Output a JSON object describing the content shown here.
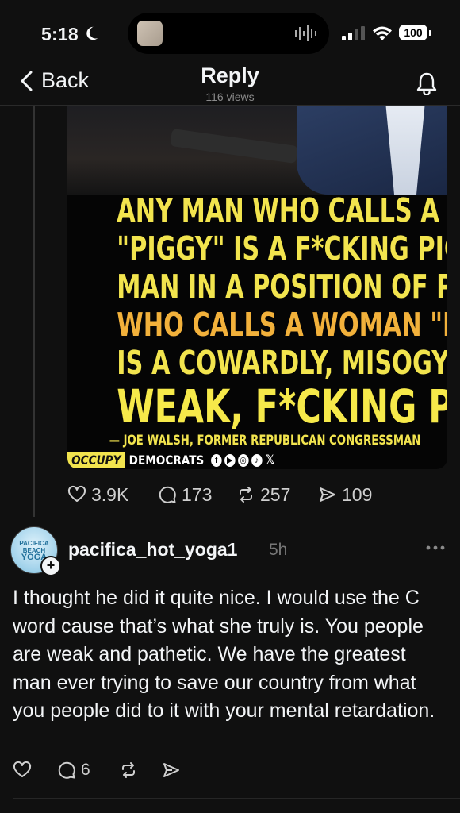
{
  "status_bar": {
    "time": "5:18",
    "battery": "100"
  },
  "nav": {
    "back_label": "Back",
    "title": "Reply",
    "views": "116 views"
  },
  "media": {
    "quote_lines": [
      "ANY MAN WHO CALLS A WOMAN",
      "\"PIGGY\" IS A F*CKING PIG. ANY",
      "MAN IN A POSITION OF POWER",
      "WHO CALLS A WOMAN \"PIGGY\"",
      "IS A COWARDLY, MISOGYNISTIC,",
      "WEAK, F*CKING PIG."
    ],
    "attribution": "— JOE WALSH, FORMER REPUBLICAN CONGRESSMAN",
    "brand_occupy": "OCCUPY",
    "brand_democrats": "DEMOCRATS"
  },
  "parent_actions": {
    "likes": "3.9K",
    "comments": "173",
    "reposts": "257",
    "shares": "109"
  },
  "reply": {
    "avatar_text_1": "PACIFICA",
    "avatar_text_2": "BEACH",
    "avatar_text_3": "YOGA",
    "username": "pacifica_hot_yoga1",
    "time_ago": "5h",
    "text": "I thought he did it quite nice. I would use the C word cause that’s what she truly is. You people are weak and pathetic. We have the greatest man ever trying to save our country from what you people did to it with your mental retardation.",
    "comments": "6"
  },
  "icons": [
    "moon-icon",
    "waveform-icon",
    "signal-icon",
    "wifi-icon",
    "battery-icon",
    "chevron-left-icon",
    "bell-icon",
    "heart-icon",
    "comment-icon",
    "repost-icon",
    "share-icon",
    "more-icon",
    "plus-icon"
  ],
  "colors": {
    "background": "#101010",
    "text": "#f3f5f7",
    "muted": "#777777",
    "quote_yellow": "#f2e44e",
    "quote_orange": "#f2b13b"
  }
}
